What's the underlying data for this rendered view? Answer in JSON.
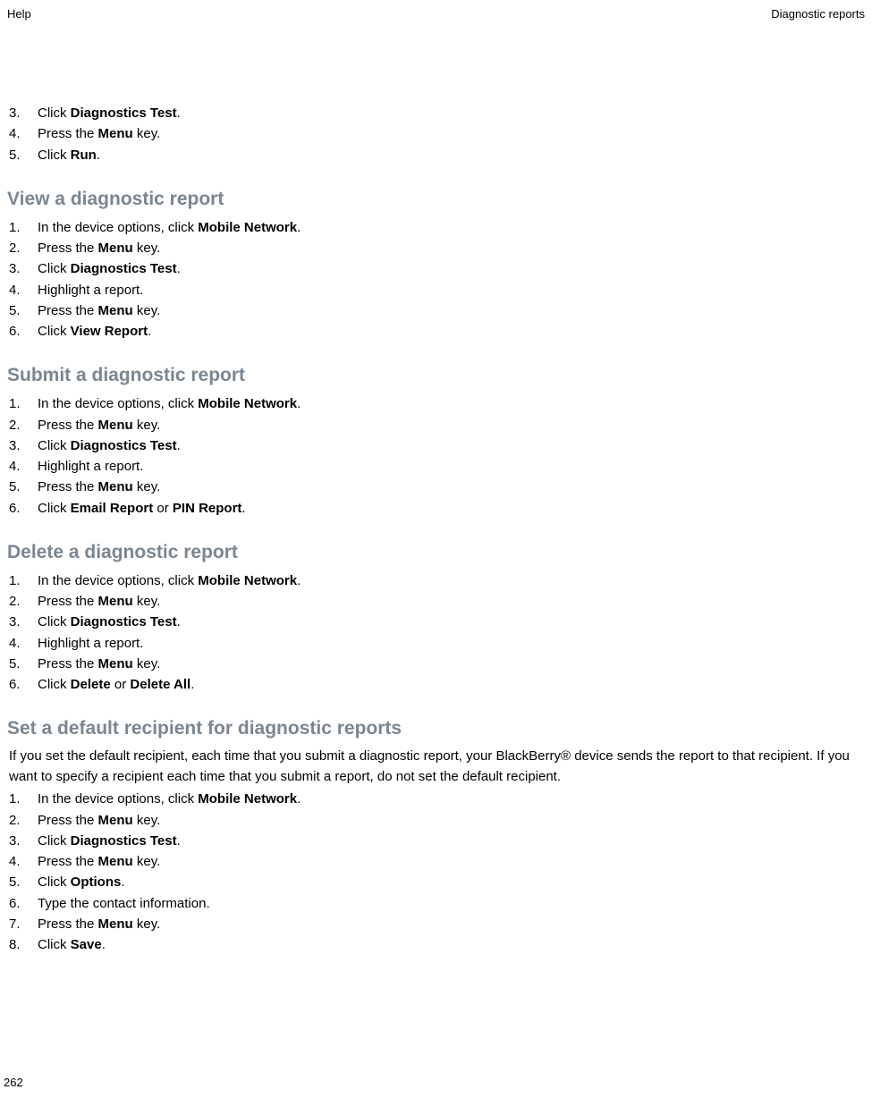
{
  "header": {
    "left": "Help",
    "right": "Diagnostic reports"
  },
  "topList": [
    {
      "pre": "Click ",
      "b1": "Diagnostics Test",
      "post": "."
    },
    {
      "pre": "Press the ",
      "b1": "Menu",
      "post": " key."
    },
    {
      "pre": "Click ",
      "b1": "Run",
      "post": "."
    }
  ],
  "sections": [
    {
      "heading": "View a diagnostic report",
      "intro": "",
      "items": [
        {
          "pre": "In the device options, click ",
          "b1": "Mobile Network",
          "post": "."
        },
        {
          "pre": "Press the ",
          "b1": "Menu",
          "post": " key."
        },
        {
          "pre": "Click ",
          "b1": "Diagnostics Test",
          "post": "."
        },
        {
          "pre": "Highlight a report.",
          "b1": "",
          "post": ""
        },
        {
          "pre": "Press the ",
          "b1": "Menu",
          "post": " key."
        },
        {
          "pre": "Click ",
          "b1": "View Report",
          "post": "."
        }
      ]
    },
    {
      "heading": "Submit a diagnostic report",
      "intro": "",
      "items": [
        {
          "pre": "In the device options, click ",
          "b1": "Mobile Network",
          "post": "."
        },
        {
          "pre": "Press the ",
          "b1": "Menu",
          "post": " key."
        },
        {
          "pre": "Click ",
          "b1": "Diagnostics Test",
          "post": "."
        },
        {
          "pre": "Highlight a report.",
          "b1": "",
          "post": ""
        },
        {
          "pre": "Press the ",
          "b1": "Menu",
          "post": " key."
        },
        {
          "pre": "Click ",
          "b1": "Email Report",
          "mid": " or ",
          "b2": "PIN Report",
          "post": "."
        }
      ]
    },
    {
      "heading": "Delete a diagnostic report",
      "intro": "",
      "items": [
        {
          "pre": "In the device options, click ",
          "b1": "Mobile Network",
          "post": "."
        },
        {
          "pre": "Press the ",
          "b1": "Menu",
          "post": " key."
        },
        {
          "pre": "Click ",
          "b1": "Diagnostics Test",
          "post": "."
        },
        {
          "pre": "Highlight a report.",
          "b1": "",
          "post": ""
        },
        {
          "pre": "Press the ",
          "b1": "Menu",
          "post": " key."
        },
        {
          "pre": "Click ",
          "b1": "Delete",
          "mid": " or ",
          "b2": "Delete All",
          "post": "."
        }
      ]
    },
    {
      "heading": "Set a default recipient for diagnostic reports",
      "intro": "If you set the default recipient, each time that you submit a diagnostic report, your BlackBerry® device sends the report to that recipient. If you want to specify a recipient each time that you submit a report, do not set the default recipient.",
      "items": [
        {
          "pre": "In the device options, click ",
          "b1": "Mobile Network",
          "post": "."
        },
        {
          "pre": "Press the ",
          "b1": "Menu",
          "post": " key."
        },
        {
          "pre": "Click ",
          "b1": "Diagnostics Test",
          "post": "."
        },
        {
          "pre": "Press the ",
          "b1": "Menu",
          "post": " key."
        },
        {
          "pre": "Click ",
          "b1": "Options",
          "post": "."
        },
        {
          "pre": "Type the contact information.",
          "b1": "",
          "post": ""
        },
        {
          "pre": "Press the ",
          "b1": "Menu",
          "post": " key."
        },
        {
          "pre": "Click ",
          "b1": "Save",
          "post": "."
        }
      ]
    }
  ],
  "pageNumber": "262"
}
